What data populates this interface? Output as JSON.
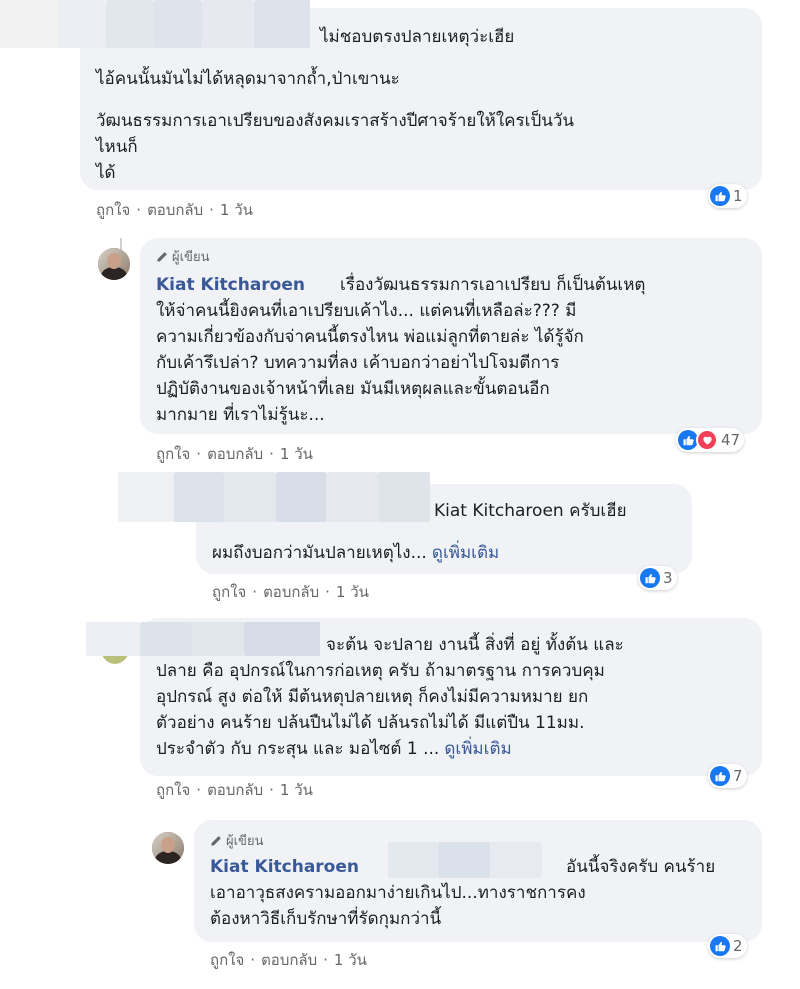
{
  "labels": {
    "like": "ถูกใจ",
    "reply": "ตอบกลับ",
    "dot": "·",
    "author_badge": "ผู้เขียน",
    "see_more": "ดูเพิ่มเติม"
  },
  "comments": [
    {
      "author": "",
      "lines": [
        "ไม่ชอบตรงปลายเหตุว่ะเฮีย",
        "ไอ้คนนั้นมันไม่ได้หลุดมาจากถ้ำ,ป่าเขานะ",
        "วัฒนธรรมการเอาเปรียบของสังคมเราสร้างปีศาจร้ายให้ใครเป็นวัน\nไหนก็\nได้"
      ],
      "time": "1 วัน",
      "reactions": "1"
    },
    {
      "author": "Kiat Kitcharoen",
      "text": "เรื่องวัฒนธรรมการเอาเปรียบ ก็เป็นต้นเหตุ\nให้จ่าคนนี้ยิงคนที่เอาเปรียบเค้าไง... แต่คนที่เหลือล่ะ??? มี\nความเกี่ยวข้องกับจ่าคนนี้ตรงไหน พ่อแม่ลูกที่ตายล่ะ ได้รู้จัก\nกับเค้ารึเปล่า? บทความที่ลง เค้าบอกว่าอย่าไปโจมตีการ\nปฏิบัติงานของเจ้าหน้าที่เลย มันมีเหตุผลและขั้นตอนอีก\nมากมาย ที่เราไม่รู้นะ...",
      "time": "1 วัน",
      "reactions": "47"
    },
    {
      "author": "",
      "line1": "Kiat Kitcharoen ครับเฮีย",
      "line2": "ผมถึงบอกว่ามันปลายเหตุไง...",
      "time": "1 วัน",
      "reactions": "3"
    },
    {
      "author": "",
      "text_first": "จะต้น จะปลาย งานนี้ สิ่งที่ อยู่ ทั้งต้น และ",
      "text": "ปลาย คือ อุปกรณ์ในการก่อเหตุ ครับ ถ้ามาตรฐาน การควบคุม\nอุปกรณ์ สูง ต่อให้ มีต้นหตุปลายเหตุ ก็คงไม่มีความหมาย ยก\nตัวอย่าง คนร้าย ปล้นปืนไม่ได้ ปล้นรถไม่ได้ มีแต่ปืน 11มม.",
      "text_last": "ประจำตัว กับ กระสุน และ มอไซต์ 1 ...",
      "time": "1 วัน",
      "reactions": "7"
    },
    {
      "author": "Kiat Kitcharoen",
      "text_first": "อันนี้จริงครับ คนร้าย",
      "text": "เอาอาวุธสงครามออกมาง่ายเกินไป...ทางราชการคง\nต้องหาวิธีเก็บรักษาที่รัดกุมกว่านี้",
      "time": "1 วัน",
      "reactions": "2"
    }
  ],
  "icons": [
    "pencil-icon",
    "like-icon",
    "heart-icon"
  ],
  "colors": {
    "bubble": "#f0f2f5",
    "like": "#1877f2",
    "heart": "#f33e58",
    "name": "#385898",
    "meta": "#65676b"
  }
}
